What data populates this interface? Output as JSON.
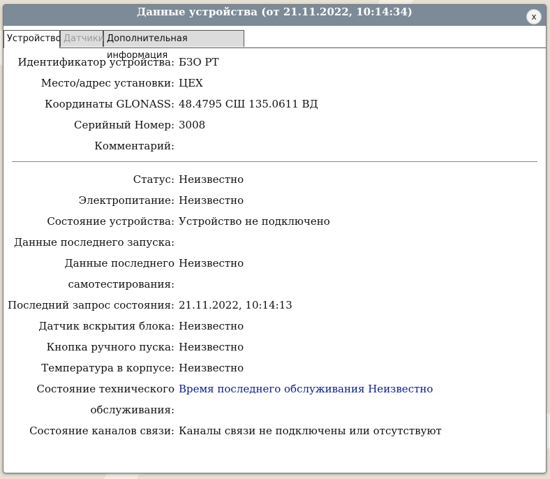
{
  "dialog": {
    "title": "Данные устройства (от 21.11.2022, 10:14:34)",
    "close_label": "x"
  },
  "tabs": [
    {
      "label": "Устройство",
      "state": "active"
    },
    {
      "label": "Датчики",
      "state": "disabled"
    },
    {
      "label": "Дополнительная информация",
      "state": "normal"
    }
  ],
  "device": {
    "id_label": "Идентификатор устройства:",
    "id_value": "БЗО РТ",
    "place_label": "Место/адрес установки:",
    "place_value": "ЦЕХ",
    "coords_label": "Координаты GLONASS:",
    "coords_value": "48.4795 СШ 135.0611 ВД",
    "serial_label": "Серийный Номер:",
    "serial_value": "3008",
    "comment_label": "Комментарий:",
    "comment_value": ""
  },
  "status": {
    "status_label": "Статус:",
    "status_value": "Неизвестно",
    "power_label": "Электропитание:",
    "power_value": "Неизвестно",
    "state_label": "Состояние устройства:",
    "state_value": "Устройство не подключено",
    "last_launch_label": "Данные последнего запуска:",
    "last_launch_value": "",
    "selftest_label_1": "Данные последнего",
    "selftest_label_2": "самотестирования:",
    "selftest_value": "Неизвестно",
    "last_request_label": "Последний запрос состояния:",
    "last_request_value": "21.11.2022, 10:14:13",
    "tamper_label": "Датчик вскрытия блока:",
    "tamper_value": "Неизвестно",
    "manual_button_label": "Кнопка ручного пуска:",
    "manual_button_value": "Неизвестно",
    "temperature_label": "Температура в корпусе:",
    "temperature_value": "Неизвестно",
    "maintenance_label_1": "Состояние технического",
    "maintenance_label_2": "обслуживания:",
    "maintenance_value": "Время последнего обслуживания Неизвестно",
    "channels_label": "Состояние каналов связи:",
    "channels_value": "Каналы связи не подключены или отсутствуют"
  },
  "colors": {
    "titlebar": "#7d8a97",
    "link": "#0b1c8c"
  }
}
